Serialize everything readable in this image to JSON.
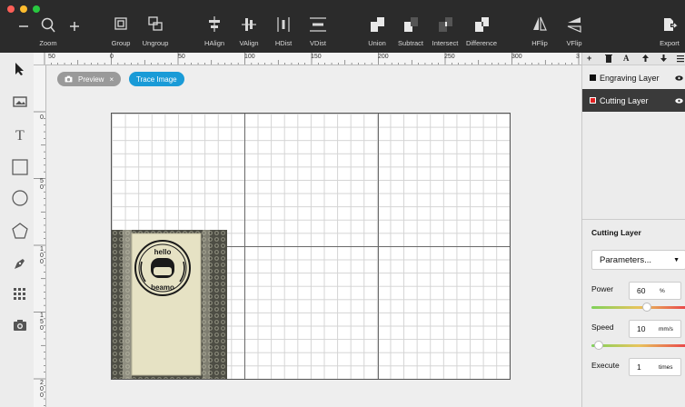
{
  "toolbar": {
    "zoom_label": "Zoom",
    "group_label": "Group",
    "ungroup_label": "Ungroup",
    "halign_label": "HAlign",
    "valign_label": "VAlign",
    "hdist_label": "HDist",
    "vdist_label": "VDist",
    "union_label": "Union",
    "subtract_label": "Subtract",
    "intersect_label": "Intersect",
    "difference_label": "Difference",
    "hflip_label": "HFlip",
    "vflip_label": "VFlip",
    "export_label": "Export"
  },
  "rulers": {
    "top": [
      "50",
      "0",
      "50",
      "100",
      "150",
      "200",
      "250",
      "300",
      "3"
    ],
    "left": [
      "0",
      "5\n0",
      "1\n0\n0",
      "1\n5\n0",
      "2\n0\n0"
    ]
  },
  "canvas": {
    "preview_label": "Preview",
    "preview_close": "×",
    "trace_label": "Trace Image",
    "photo_top_text": "hello",
    "photo_bottom_text": "beamo"
  },
  "layers": {
    "items": [
      {
        "name": "Engraving Layer",
        "color": "#111111",
        "selected": false
      },
      {
        "name": "Cutting Layer",
        "color": "#e02020",
        "selected": true
      }
    ]
  },
  "properties": {
    "title": "Cutting Layer",
    "parameters": "Parameters...",
    "power_label": "Power",
    "power_value": "60",
    "power_unit": "%",
    "power_fraction": 0.6,
    "speed_label": "Speed",
    "speed_value": "10",
    "speed_unit": "mm/s",
    "speed_fraction": 0.03,
    "execute_label": "Execute",
    "execute_value": "1",
    "execute_unit": "times"
  },
  "colors": {
    "toolbar_bg": "#2b2b2b",
    "accent_blue": "#1a9bd7",
    "selected_layer_bg": "#3a3a3a"
  }
}
